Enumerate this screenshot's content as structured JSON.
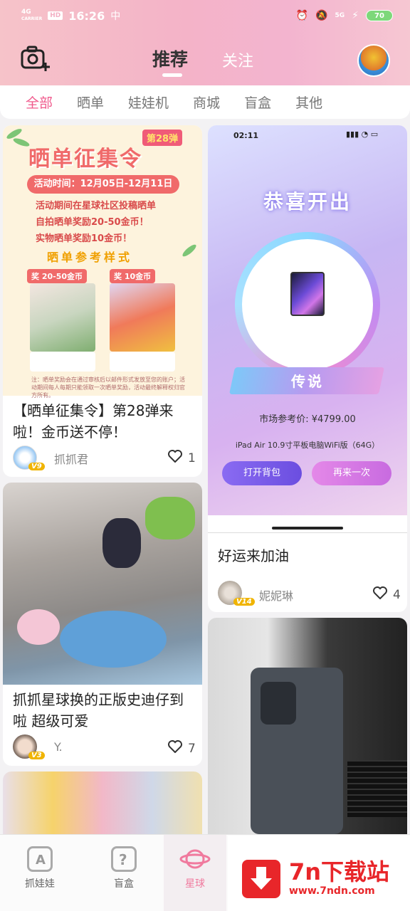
{
  "status_bar": {
    "network": "4G",
    "carrier_label": "CARRIER",
    "hd": "HD",
    "time": "16:26",
    "extra_icon": "中",
    "signal_label": "5G",
    "battery": "70"
  },
  "header": {
    "tabs": [
      {
        "label": "推荐",
        "active": true
      },
      {
        "label": "关注",
        "active": false
      }
    ]
  },
  "categories": [
    {
      "label": "全部",
      "active": true
    },
    {
      "label": "晒单",
      "active": false
    },
    {
      "label": "娃娃机",
      "active": false
    },
    {
      "label": "商城",
      "active": false
    },
    {
      "label": "盲盒",
      "active": false
    },
    {
      "label": "其他",
      "active": false
    }
  ],
  "feed": {
    "card1": {
      "poster": {
        "badge": "第28弹",
        "headline": "晒单征集令",
        "date": "活动时间：12月05日-12月11日",
        "line1": "活动期间在星球社区投稿晒单",
        "line2": "自拍晒单奖励20-50金币！",
        "line3": "实物晒单奖励10金币！",
        "sub": "晒单参考样式",
        "tag1": "奖 20-50金币",
        "tag2": "奖 10金币",
        "footnote": "注：晒单奖励会在通过审核后以邮件形式发放至您的账户；活动期间每人每期只能领取一次晒单奖励，活动最终解释权归官方所有。"
      },
      "title": "【晒单征集令】第28弹来啦！金币送不停！",
      "level": "V9",
      "user": "抓抓君",
      "likes": "1"
    },
    "card2": {
      "title": "抓抓星球换的正版史迪仔到啦 超级可爱",
      "level": "V3",
      "user": "Y.",
      "likes": "7"
    },
    "card3": {
      "phone_time": "02:11",
      "congrats": "恭喜开出",
      "rarity": "传说",
      "price": "市场参考价: ¥4799.00",
      "product": "iPad Air 10.9寸平板电脑WiFi版（64G）",
      "btn_open": "打开背包",
      "btn_again": "再来一次",
      "title": "好运来加油",
      "level": "V14",
      "user": "妮妮琳",
      "likes": "4"
    }
  },
  "bottom_nav": [
    {
      "label": "抓娃娃",
      "icon": "claw-machine-icon",
      "active": false
    },
    {
      "label": "盲盒",
      "icon": "mystery-box-icon",
      "active": false
    },
    {
      "label": "星球",
      "icon": "planet-icon",
      "active": true
    }
  ],
  "watermark": {
    "title": "7n下载站",
    "url": "www.7ndn.com"
  },
  "colors": {
    "accent": "#f05b8d",
    "header_gradient": "#f4b3c8",
    "watermark_red": "#e8262a"
  }
}
